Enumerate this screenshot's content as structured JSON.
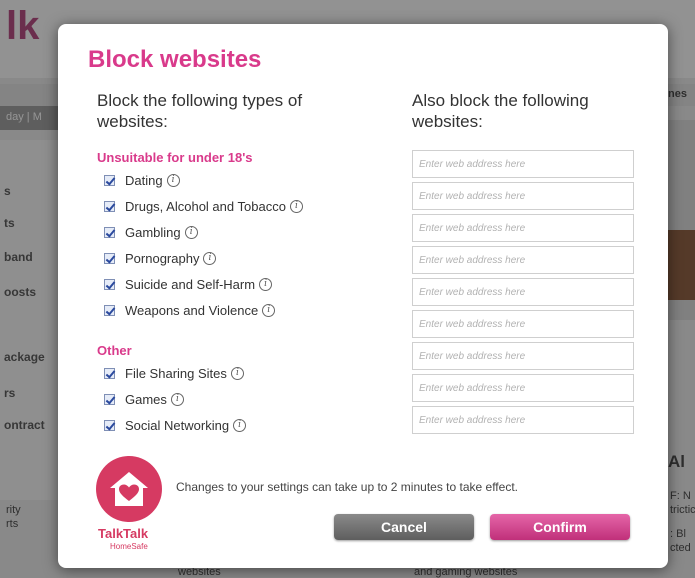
{
  "background": {
    "logo": "lk",
    "subnav": "day | M",
    "sidebar_items": [
      "s",
      "ts",
      "band",
      "oosts",
      "ackage",
      "rs",
      "ontract"
    ],
    "right_letters": "nes",
    "right_heading": "Al",
    "right_lines": [
      "F: N",
      "trictic",
      ": Bl",
      "cted"
    ],
    "left_bottom": [
      "rity",
      "rts"
    ],
    "bottom_texts": [
      "websites",
      "and gaming websites"
    ]
  },
  "modal": {
    "title": "Block websites",
    "left_heading": "Block the following types of websites:",
    "right_heading": "Also block the following websites:",
    "sections": [
      {
        "heading": "Unsuitable for under 18's",
        "items": [
          "Dating",
          "Drugs, Alcohol and Tobacco",
          "Gambling",
          "Pornography",
          "Suicide and Self-Harm",
          "Weapons and Violence"
        ]
      },
      {
        "heading": "Other",
        "items": [
          "File Sharing Sites",
          "Games",
          "Social Networking"
        ]
      }
    ],
    "input_placeholder": "Enter web address here",
    "input_count": 9,
    "logo": {
      "name": "TalkTalk",
      "sub": "HomeSafe"
    },
    "notice": "Changes to your settings can take up to 2 minutes to take effect.",
    "cancel_label": "Cancel",
    "confirm_label": "Confirm"
  },
  "colors": {
    "accent": "#d93a8b",
    "logo": "#d63a62",
    "confirm": "#c0307a",
    "cancel": "#6e6e6e"
  },
  "icons": [
    "info-icon",
    "checkbox-checked",
    "house-heart-icon"
  ]
}
